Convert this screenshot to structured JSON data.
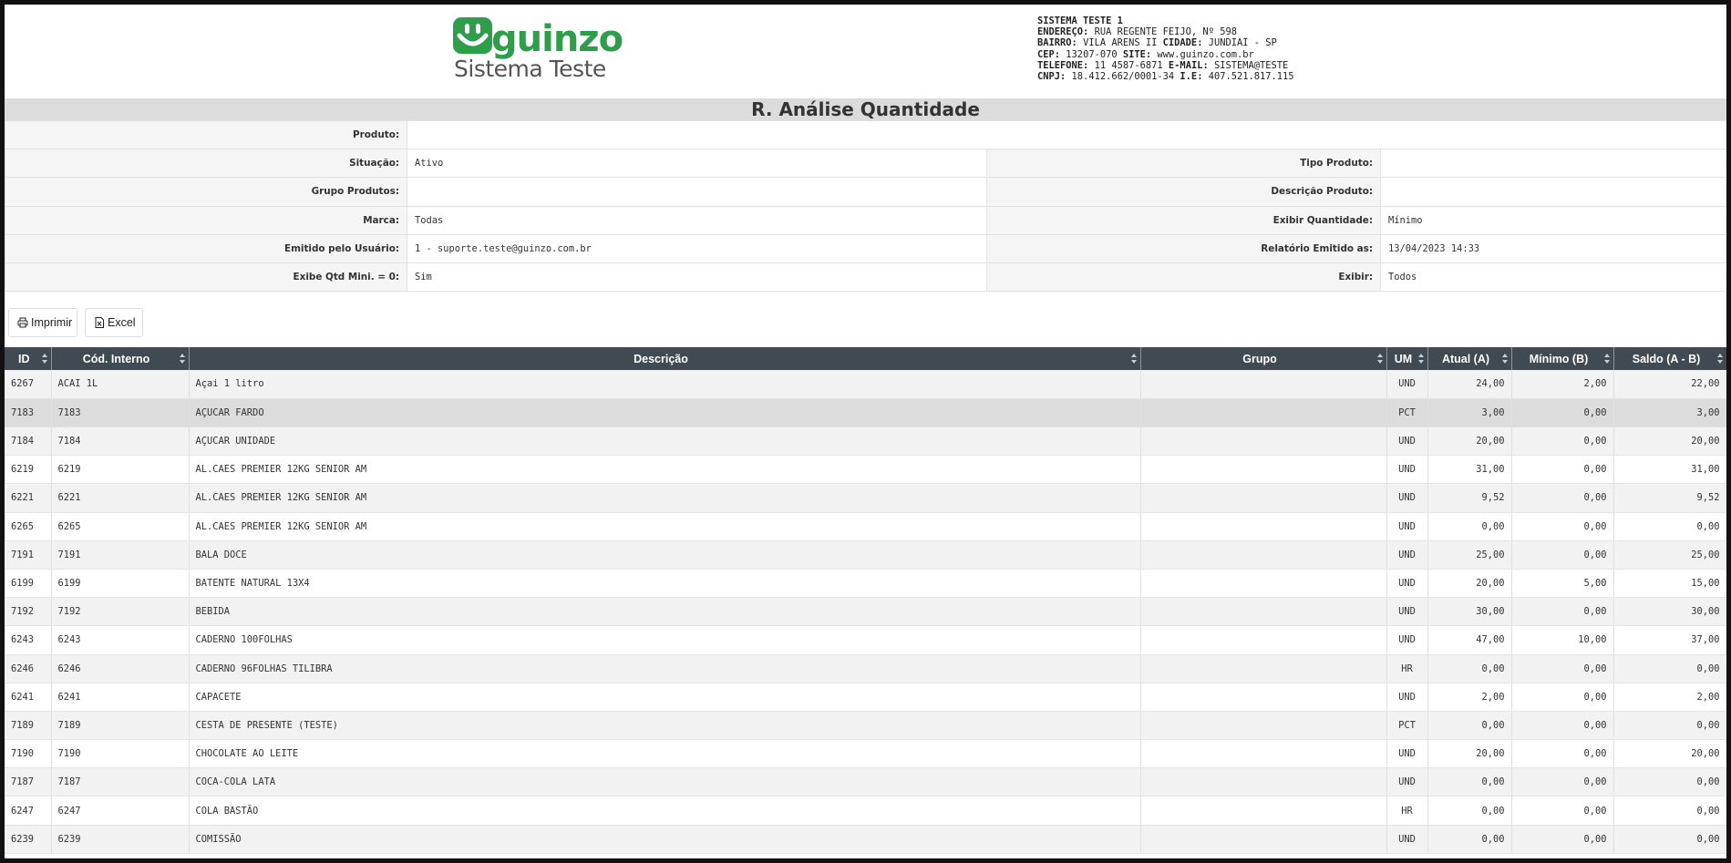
{
  "header": {
    "logo_brand": "guinzo",
    "logo_tagline": "Sistema Teste",
    "company": {
      "name": "SISTEMA TESTE 1",
      "endereco_label": "ENDEREÇO:",
      "endereco": "RUA REGENTE FEIJO, Nº 598",
      "bairro_label": "BAIRRO:",
      "bairro": "VILA ARENS II",
      "cidade_label": "CIDADE:",
      "cidade": "JUNDIAI - SP",
      "cep_label": "CEP:",
      "cep": "13207-070",
      "site_label": "SITE:",
      "site": "www.guinzo.com.br",
      "telefone_label": "TELEFONE:",
      "telefone": "11 4587-6871",
      "email_label": "E-MAIL:",
      "email": "SISTEMA@TESTE",
      "cnpj_label": "CNPJ:",
      "cnpj": "18.412.662/0001-34",
      "ie_label": "I.E:",
      "ie": "407.521.817.115"
    }
  },
  "report_title": "R. Análise Quantidade",
  "filters": {
    "produto_label": "Produto:",
    "produto": "",
    "situacao_label": "Situação:",
    "situacao": "Ativo",
    "tipo_produto_label": "Tipo Produto:",
    "tipo_produto": "",
    "grupo_produtos_label": "Grupo Produtos:",
    "grupo_produtos": "",
    "descricao_produto_label": "Descrição Produto:",
    "descricao_produto": "",
    "marca_label": "Marca:",
    "marca": "Todas",
    "exibir_quantidade_label": "Exibir Quantidade:",
    "exibir_quantidade": "Mínimo",
    "emitido_usuario_label": "Emitido pelo Usuário:",
    "emitido_usuario": "1 - suporte.teste@guinzo.com.br",
    "relatorio_emitido_label": "Relatório Emitido as:",
    "relatorio_emitido": "13/04/2023 14:33",
    "exibe_qtd_label": "Exibe Qtd Mini. = 0:",
    "exibe_qtd": "Sim",
    "exibir_label": "Exibir:",
    "exibir": "Todos"
  },
  "toolbar": {
    "print_label": "Imprimir",
    "excel_label": "Excel",
    "print_icon": "printer-icon",
    "excel_icon": "excel-file-icon"
  },
  "table": {
    "columns": [
      "ID",
      "Cód. Interno",
      "Descrição",
      "Grupo",
      "UM",
      "Atual (A)",
      "Mínimo (B)",
      "Saldo (A - B)"
    ],
    "rows": [
      [
        "6267",
        "ACAI 1L",
        "Açai 1 litro",
        "",
        "UND",
        "24,00",
        "2,00",
        "22,00"
      ],
      [
        "7183",
        "7183",
        "AÇUCAR FARDO",
        "",
        "PCT",
        "3,00",
        "0,00",
        "3,00"
      ],
      [
        "7184",
        "7184",
        "AÇUCAR UNIDADE",
        "",
        "UND",
        "20,00",
        "0,00",
        "20,00"
      ],
      [
        "6219",
        "6219",
        "AL.CAES PREMIER 12KG SENIOR AM",
        "",
        "UND",
        "31,00",
        "0,00",
        "31,00"
      ],
      [
        "6221",
        "6221",
        "AL.CAES PREMIER 12KG SENIOR AM",
        "",
        "UND",
        "9,52",
        "0,00",
        "9,52"
      ],
      [
        "6265",
        "6265",
        "AL.CAES PREMIER 12KG SENIOR AM",
        "",
        "UND",
        "0,00",
        "0,00",
        "0,00"
      ],
      [
        "7191",
        "7191",
        "BALA DOCE",
        "",
        "UND",
        "25,00",
        "0,00",
        "25,00"
      ],
      [
        "6199",
        "6199",
        "BATENTE NATURAL 13X4",
        "",
        "UND",
        "20,00",
        "5,00",
        "15,00"
      ],
      [
        "7192",
        "7192",
        "BEBIDA",
        "",
        "UND",
        "30,00",
        "0,00",
        "30,00"
      ],
      [
        "6243",
        "6243",
        "CADERNO 100FOLHAS",
        "",
        "UND",
        "47,00",
        "10,00",
        "37,00"
      ],
      [
        "6246",
        "6246",
        "CADERNO 96FOLHAS TILIBRA",
        "",
        "HR",
        "0,00",
        "0,00",
        "0,00"
      ],
      [
        "6241",
        "6241",
        "CAPACETE",
        "",
        "UND",
        "2,00",
        "0,00",
        "2,00"
      ],
      [
        "7189",
        "7189",
        "CESTA DE PRESENTE (TESTE)",
        "",
        "PCT",
        "0,00",
        "0,00",
        "0,00"
      ],
      [
        "7190",
        "7190",
        "CHOCOLATE AO LEITE",
        "",
        "UND",
        "20,00",
        "0,00",
        "20,00"
      ],
      [
        "7187",
        "7187",
        "COCA-COLA LATA",
        "",
        "UND",
        "0,00",
        "0,00",
        "0,00"
      ],
      [
        "6247",
        "6247",
        "COLA BASTÃO",
        "",
        "HR",
        "0,00",
        "0,00",
        "0,00"
      ],
      [
        "6239",
        "6239",
        "COMISSÃO",
        "",
        "UND",
        "0,00",
        "0,00",
        "0,00"
      ]
    ]
  },
  "colors": {
    "brand_green": "#2e9e4b",
    "header_dark": "#404a52",
    "title_bg": "#dcdcdc"
  }
}
